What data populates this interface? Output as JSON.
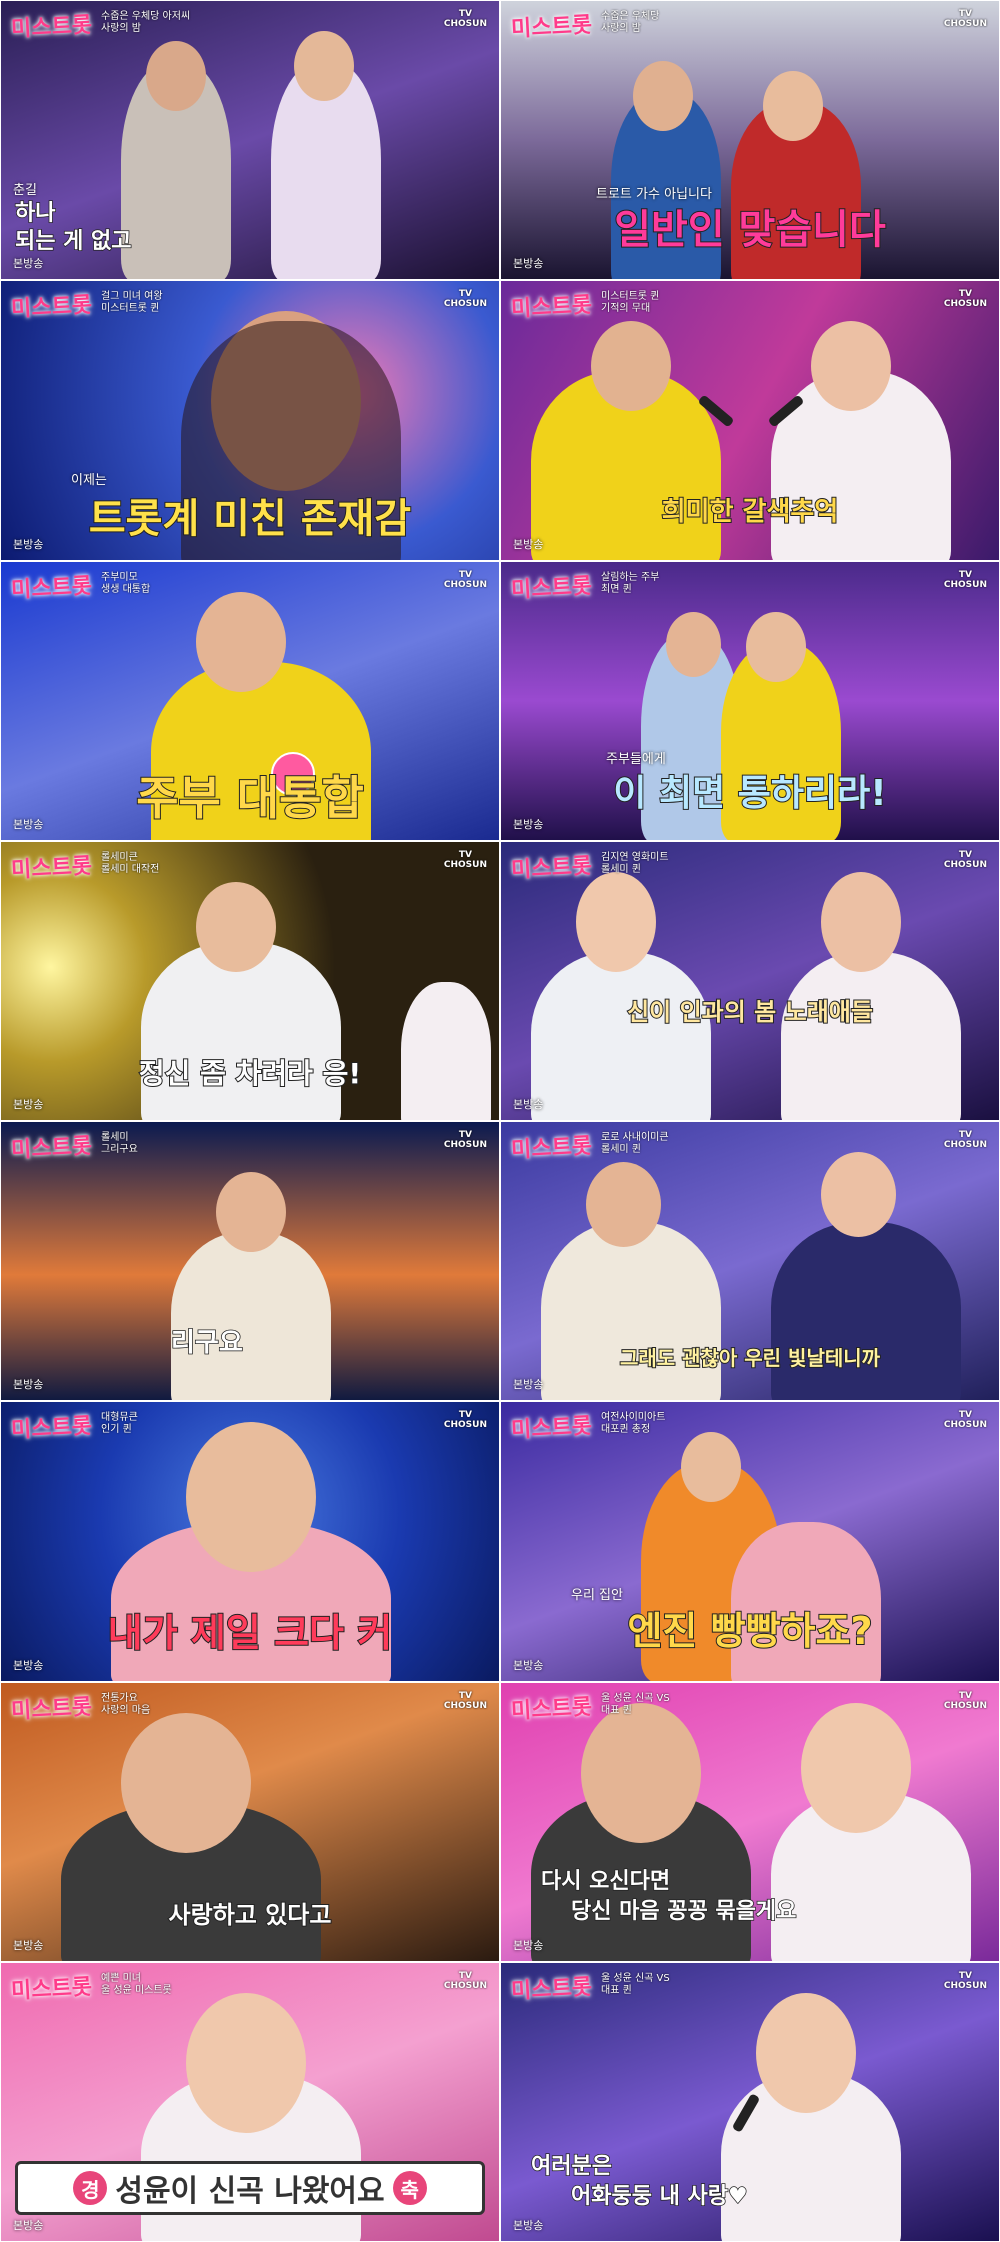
{
  "common": {
    "show_logo": "미스트롯",
    "tv_label": "TV\nCHOSUN",
    "tag": "본방송"
  },
  "panels": [
    {
      "small_title": "수줍은 우체당 아저씨\n사랑의 밤",
      "pre": "춘길",
      "caption_lines": [
        "하나",
        "되는 게 없고"
      ],
      "bg": "#3a2d6a"
    },
    {
      "small_title": "수줍은 우체당\n사랑의 밤",
      "pre": "트로트 가수 아닙니다",
      "caption": "일반인 맞습니다",
      "bg": "#5b4f86"
    },
    {
      "small_title": "걸그 미녀 여왕\n미스터트롯 퀸",
      "pre": "이제는",
      "caption": "트롯계 미친 존재감",
      "bg": "#1c3a98"
    },
    {
      "small_title": "미스터트롯 퀸\n기적의 무대",
      "caption": "희미한 갈색추억",
      "bg": "#5a3aa0"
    },
    {
      "small_title": "주부미모\n생생 대통합",
      "caption": "주부 대통합",
      "bg": "#2946c6"
    },
    {
      "small_title": "살림하는 주부\n최면 퀸",
      "pre": "주부들에게",
      "caption": "이 최면 통하리라!",
      "bg": "#702fae"
    },
    {
      "small_title": "롤세미큰\n롤세미 대작전",
      "caption": "정신 좀 차려라 응!",
      "bg": "#7a5a1c"
    },
    {
      "small_title": "김지연 영화미트\n롤세미 퀸",
      "caption": "신이 인과의 봄 노래애들",
      "bg": "#2d2a6a"
    },
    {
      "small_title": "롤세미\n그리구요",
      "caption": "리구요",
      "bg": "#1b2f6a"
    },
    {
      "small_title": "로로 사내이미큰\n롤세미 퀸",
      "caption": "그래도 괜찮아 우린 빛날테니까",
      "bg": "#3b3a88"
    },
    {
      "small_title": "대형뮤큰\n인기 퀸",
      "caption": "내가 제일 크다 커",
      "bg": "#2043b0"
    },
    {
      "small_title": "여전사이미아트\n대포퀸 총정",
      "pre": "우리 집안",
      "caption": "엔진 빵빵하죠?",
      "bg": "#4a38a6"
    },
    {
      "small_title": "전통가요\n사랑의 마음",
      "caption": "사랑하고 있다고",
      "bg": "#7a3a20"
    },
    {
      "small_title": "울 성윤 신곡 VS\n대표 퀸",
      "caption_lines": [
        "다시 오신다면",
        "당신 마음 꽁꽁 묶을게요"
      ],
      "bg": "#c02a9a"
    },
    {
      "small_title": "예쁜 미녀\n울 성윤 미스트롯",
      "banner_left": "경",
      "banner_text": "성윤이 신곡 나왔어요",
      "banner_right": "축",
      "bg": "#e06aa8"
    },
    {
      "small_title": "울 성윤 신곡 VS\n대표 퀸",
      "caption_lines": [
        "여러분은",
        "어화둥둥 내 사랑♥"
      ],
      "bg": "#3a2b7a"
    }
  ]
}
